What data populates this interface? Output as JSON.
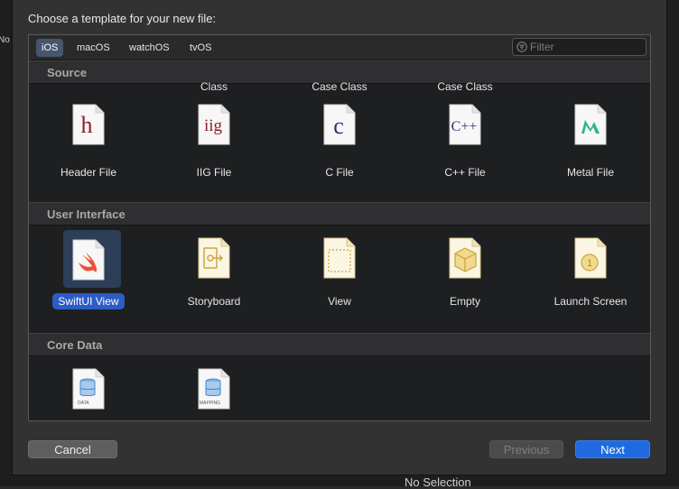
{
  "background": {
    "left_truncated_text": "No",
    "bottom_truncated_text": "No Selection"
  },
  "dialog": {
    "title": "Choose a template for your new file:",
    "platform_tabs": [
      {
        "label": "iOS",
        "selected": true
      },
      {
        "label": "macOS",
        "selected": false
      },
      {
        "label": "watchOS",
        "selected": false
      },
      {
        "label": "tvOS",
        "selected": false
      }
    ],
    "filter": {
      "placeholder": "Filter",
      "value": ""
    },
    "sections": {
      "source": {
        "title": "Source",
        "clipped_labels": [
          "Class",
          "Case Class",
          "Case Class"
        ],
        "items": [
          {
            "label": "Header File",
            "icon": "header-file-icon",
            "glyph": "h"
          },
          {
            "label": "IIG File",
            "icon": "iig-file-icon",
            "glyph": "iig"
          },
          {
            "label": "C File",
            "icon": "c-file-icon",
            "glyph": "c"
          },
          {
            "label": "C++ File",
            "icon": "cpp-file-icon",
            "glyph": "C++"
          },
          {
            "label": "Metal File",
            "icon": "metal-file-icon",
            "glyph": "M"
          }
        ]
      },
      "user_interface": {
        "title": "User Interface",
        "items": [
          {
            "label": "SwiftUI View",
            "icon": "swift-file-icon",
            "selected": true
          },
          {
            "label": "Storyboard",
            "icon": "storyboard-file-icon"
          },
          {
            "label": "View",
            "icon": "view-file-icon"
          },
          {
            "label": "Empty",
            "icon": "empty-file-icon"
          },
          {
            "label": "Launch Screen",
            "icon": "launch-screen-file-icon",
            "glyph": "1"
          }
        ]
      },
      "core_data": {
        "title": "Core Data",
        "items": [
          {
            "icon": "data-model-file-icon",
            "doc_label": "DATA"
          },
          {
            "icon": "mapping-model-file-icon",
            "doc_label": "MAPPING"
          }
        ]
      }
    },
    "buttons": {
      "cancel": "Cancel",
      "previous": "Previous",
      "next": "Next"
    }
  },
  "colors": {
    "accent": "#1f6adf",
    "selection": "#2c5cc4",
    "header_red": "#8f1d2c",
    "c_blue": "#3a2c7a",
    "metal_green": "#2bb58a",
    "storyboard_gold": "#c9a43a"
  }
}
